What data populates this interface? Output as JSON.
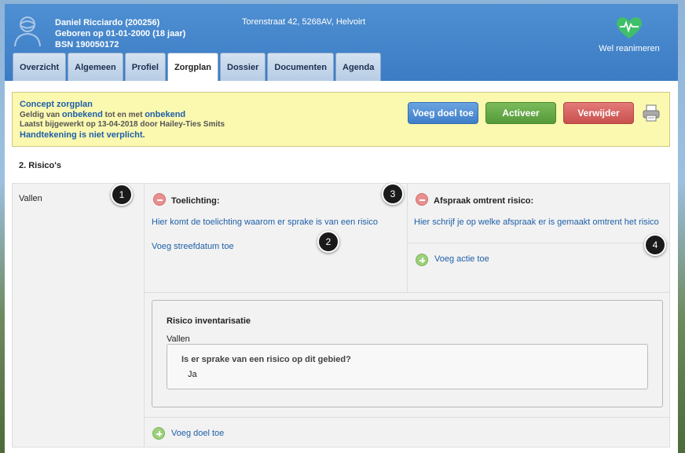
{
  "patient": {
    "name_line": "Daniel Ricciardo (200256)",
    "birth_line": "Geboren op 01-01-2000 (18 jaar)",
    "bsn_line": "BSN 190050172",
    "address": "Torenstraat 42, 5268AV, Helvoirt",
    "reanimation_status": "Wel reanimeren"
  },
  "tabs": [
    {
      "label": "Overzicht",
      "active": false
    },
    {
      "label": "Algemeen",
      "active": false
    },
    {
      "label": "Profiel",
      "active": false
    },
    {
      "label": "Zorgplan",
      "active": true
    },
    {
      "label": "Dossier",
      "active": false
    },
    {
      "label": "Documenten",
      "active": false
    },
    {
      "label": "Agenda",
      "active": false
    }
  ],
  "banner": {
    "title": "Concept zorgplan",
    "valid_prefix": "Geldig van ",
    "valid_from": "onbekend",
    "valid_mid": " tot en met ",
    "valid_to": "onbekend",
    "updated": "Laatst bijgewerkt op 13-04-2018 door Hailey-Ties Smits",
    "signature": "Handtekening is niet verplicht.",
    "buttons": {
      "add_goal": "Voeg doel toe",
      "activate": "Activeer",
      "delete": "Verwijder"
    }
  },
  "section": {
    "title": "2. Risico's",
    "risk_label": "Vallen",
    "toelichting_header": "Toelichting:",
    "toelichting_text": "Hier komt de toelichting waarom er sprake is van een risico",
    "add_target_date": "Voeg streefdatum toe",
    "afspraak_header": "Afspraak omtrent risico:",
    "afspraak_text": "Hier schrijf je op welke afspraak er is gemaakt omtrent het risico",
    "add_action": "Voeg actie toe",
    "add_goal": "Voeg doel toe"
  },
  "inventory": {
    "title": "Risico inventarisatie",
    "subject": "Vallen",
    "question": "Is er sprake van een risico op dit gebied?",
    "answer": "Ja"
  },
  "markers": [
    "1",
    "2",
    "3",
    "4"
  ],
  "colors": {
    "header_blue": "#3b7cc4",
    "link_blue": "#1e5fa8",
    "banner_yellow": "#fbf8b0",
    "button_blue": "#4f8fd2",
    "button_green": "#5fa243",
    "button_red": "#d05855"
  }
}
